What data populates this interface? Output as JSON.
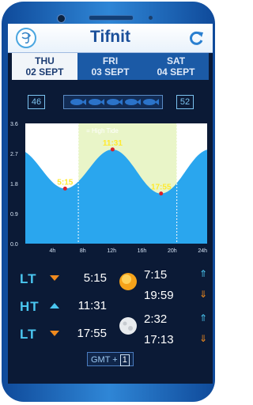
{
  "header": {
    "title": "Tifnit"
  },
  "tabs": [
    {
      "day": "THU",
      "date": "02 SEPT",
      "active": true
    },
    {
      "day": "FRI",
      "date": "03 SEPT",
      "active": false
    },
    {
      "day": "SAT",
      "date": "04 SEPT",
      "active": false
    }
  ],
  "moon_row": {
    "left_value": "46",
    "right_value": "52",
    "fish_count": 5
  },
  "chart_data": {
    "type": "area",
    "legend": "= High Tide",
    "ylim": [
      0,
      3.6
    ],
    "yticks": [
      "0.0",
      "0.9",
      "1.8",
      "2.7",
      "3.6"
    ],
    "xlim": [
      0,
      24
    ],
    "xticks": [
      "4h",
      "8h",
      "12h",
      "16h",
      "20h",
      "24h"
    ],
    "points": [
      {
        "label": "5:15",
        "x": 5.25,
        "y": 1.65
      },
      {
        "label": "11:31",
        "x": 11.52,
        "y": 2.82
      },
      {
        "label": "17:55",
        "x": 17.92,
        "y": 1.5
      }
    ],
    "high_tide_band": [
      7.0,
      20.0
    ],
    "colors": {
      "water": "#2aa6ee",
      "band": "#e9f5c8",
      "labels": "#ffea2e"
    }
  },
  "tides": [
    {
      "type": "LT",
      "time": "5:15",
      "direction": "down"
    },
    {
      "type": "HT",
      "time": "11:31",
      "direction": "up"
    },
    {
      "type": "LT",
      "time": "17:55",
      "direction": "down"
    }
  ],
  "sun": {
    "rise": "7:15",
    "set": "19:59"
  },
  "moon": {
    "rise": "2:32",
    "set": "17:13"
  },
  "gmt": {
    "label": "GMT +",
    "value": "1"
  }
}
